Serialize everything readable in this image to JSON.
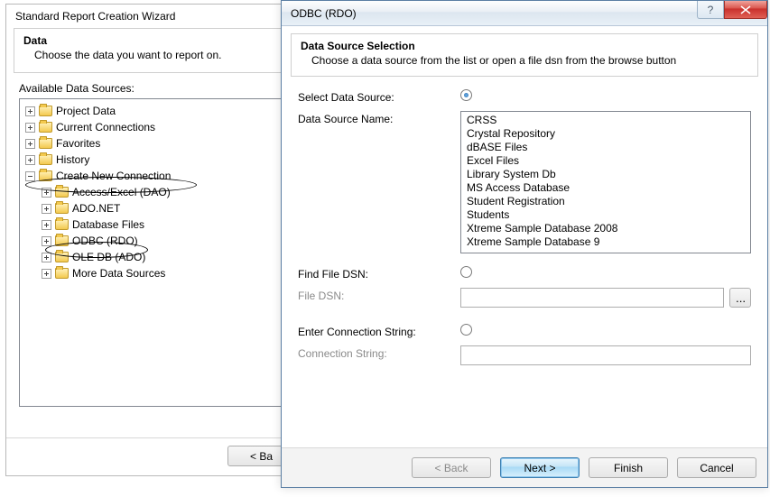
{
  "wizard": {
    "window_title": "Standard Report Creation Wizard",
    "header_title": "Data",
    "header_subtitle": "Choose the data you want to report on.",
    "available_label": "Available Data Sources:",
    "tree": {
      "top": [
        {
          "label": "Project Data",
          "exp": "plus"
        },
        {
          "label": "Current Connections",
          "exp": "plus"
        },
        {
          "label": "Favorites",
          "exp": "plus"
        },
        {
          "label": "History",
          "exp": "plus"
        },
        {
          "label": "Create New Connection",
          "exp": "minus"
        }
      ],
      "children": [
        {
          "label": "Access/Excel (DAO)",
          "exp": "plus"
        },
        {
          "label": "ADO.NET",
          "exp": "plus"
        },
        {
          "label": "Database Files",
          "exp": "plus"
        },
        {
          "label": "ODBC (RDO)",
          "exp": "plus"
        },
        {
          "label": "OLE DB (ADO)",
          "exp": "plus"
        },
        {
          "label": "More Data Sources",
          "exp": "plus"
        }
      ]
    },
    "back_button": "< Ba"
  },
  "odbc": {
    "window_title": "ODBC (RDO)",
    "help_glyph": "?",
    "header_title": "Data Source Selection",
    "header_subtitle": "Choose a data source from the list or open a file dsn from the browse button",
    "select_ds_label": "Select Data Source:",
    "dsn_label": "Data Source Name:",
    "dsn_items": [
      "CRSS",
      "Crystal Repository",
      "dBASE Files",
      "Excel Files",
      "Library System Db",
      "MS Access Database",
      "Student Registration",
      "Students",
      "Xtreme Sample Database 2008",
      "Xtreme Sample Database 9"
    ],
    "find_file_label": "Find File DSN:",
    "file_dsn_label": "File DSN:",
    "browse_label": "...",
    "enter_cs_label": "Enter Connection String:",
    "cs_label": "Connection String:",
    "buttons": {
      "back": "< Back",
      "next": "Next >",
      "finish": "Finish",
      "cancel": "Cancel"
    }
  }
}
